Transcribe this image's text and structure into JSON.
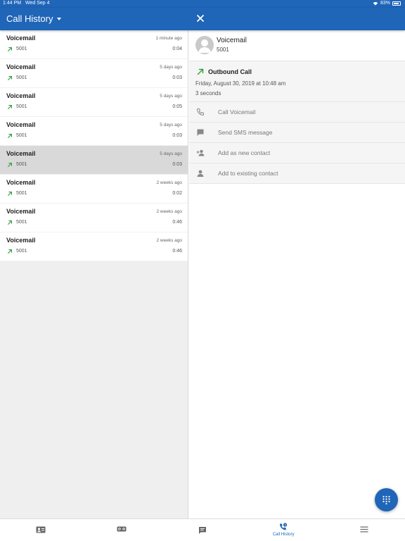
{
  "status_bar": {
    "time": "1:44 PM",
    "date": "Wed Sep 4",
    "battery": "83%"
  },
  "header": {
    "title": "Call History"
  },
  "calls": [
    {
      "name": "Voicemail",
      "time": "1 minute ago",
      "number": "5001",
      "duration": "0:04"
    },
    {
      "name": "Voicemail",
      "time": "5 days ago",
      "number": "5001",
      "duration": "0:03"
    },
    {
      "name": "Voicemail",
      "time": "5 days ago",
      "number": "5001",
      "duration": "0:05"
    },
    {
      "name": "Voicemail",
      "time": "5 days ago",
      "number": "5001",
      "duration": "0:03"
    },
    {
      "name": "Voicemail",
      "time": "5 days ago",
      "number": "5001",
      "duration": "0:03"
    },
    {
      "name": "Voicemail",
      "time": "2 weeks ago",
      "number": "5001",
      "duration": "0:02"
    },
    {
      "name": "Voicemail",
      "time": "2 weeks ago",
      "number": "5001",
      "duration": "0:46"
    },
    {
      "name": "Voicemail",
      "time": "2 weeks ago",
      "number": "5001",
      "duration": "0:46"
    }
  ],
  "selected_index": 4,
  "detail": {
    "contact_name": "Voicemail",
    "contact_number": "5001",
    "call_type": "Outbound Call",
    "call_date": "Friday, August 30, 2019 at 10:48 am",
    "call_duration": "3 seconds",
    "actions": [
      {
        "label": "Call Voicemail",
        "icon": "phone-icon"
      },
      {
        "label": "Send SMS message",
        "icon": "chat-icon"
      },
      {
        "label": "Add as new contact",
        "icon": "person-add-icon"
      },
      {
        "label": "Add to existing contact",
        "icon": "person-icon"
      }
    ]
  },
  "bottom_nav": {
    "items": [
      {
        "icon": "contacts-icon",
        "label": ""
      },
      {
        "icon": "voicemail-icon",
        "label": ""
      },
      {
        "icon": "messages-icon",
        "label": ""
      },
      {
        "icon": "call-history-icon",
        "label": "Call History"
      },
      {
        "icon": "menu-icon",
        "label": ""
      }
    ],
    "active_index": 3
  },
  "colors": {
    "brand": "#1f65b8",
    "outbound_arrow": "#2e9e3e",
    "selected_row": "#d9d9d9"
  }
}
